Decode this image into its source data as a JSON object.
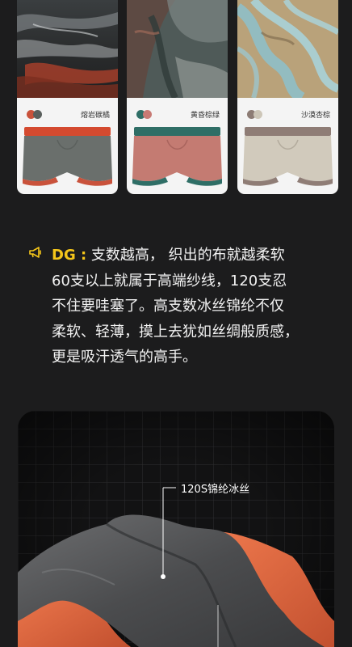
{
  "colorways": [
    {
      "name": "熔岩碳橘",
      "swatch_primary": "#c9523b",
      "swatch_secondary": "#5a5f5d",
      "waistband": "#d44a2f",
      "body": "#6a6f6c"
    },
    {
      "name": "黄昏棕绿",
      "swatch_primary": "#2f6e66",
      "swatch_secondary": "#c77a74",
      "waistband": "#2f6e66",
      "body": "#c47b72"
    },
    {
      "name": "沙漠杏棕",
      "swatch_primary": "#8d7c75",
      "swatch_secondary": "#cdc6b8",
      "waistband": "#8f7d76",
      "body": "#d1cabc"
    }
  ],
  "quote": {
    "speaker": "DG :",
    "lines": [
      " 支数越高， 织出的布就越柔软",
      "60支以上就属于高端纱线，120支忍",
      "不住要哇塞了。高支数冰丝锦纶不仅",
      "柔软、轻薄，摸上去犹如丝绸般质感，",
      "更是吸汗透气的高手。"
    ]
  },
  "fabric_callout": "120S锦纶冰丝",
  "colors": {
    "background": "#1c1c1d",
    "accent_yellow": "#f5c61a",
    "card_bg": "#f4f4f4"
  }
}
